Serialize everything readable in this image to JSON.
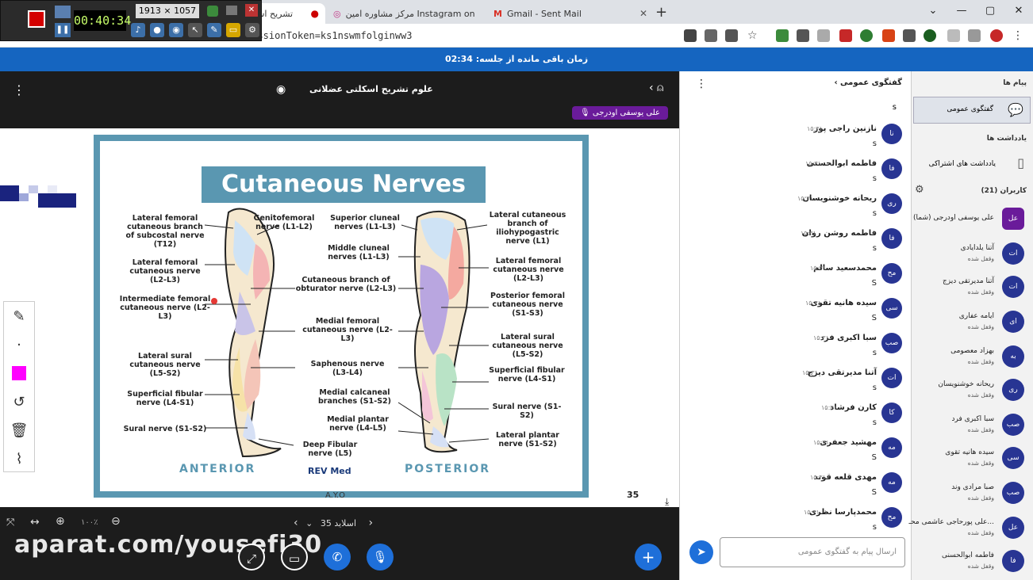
{
  "browser": {
    "tabs": [
      {
        "label": "تشریح اس"
      },
      {
        "label": "مرکز مشاوره امین Instagram on"
      },
      {
        "label": "Gmail - Sent Mail"
      }
    ],
    "url": "sessionToken=ks1nswmfolginww3"
  },
  "recorder": {
    "time": "00:40:34",
    "resolution": "1913 × 1057"
  },
  "banner": {
    "text": "زمان باقی مانده از جلسه: 02:34"
  },
  "presentation": {
    "title": "علوم تشریح اسکلتی عضلانی",
    "presenter": "علی یوسفی اودرجی",
    "slide": {
      "title": "Cutaneous Nerves",
      "anterior": "ANTERIOR",
      "posterior": "POSTERIOR",
      "brand": "REV Med",
      "page": "35",
      "footer": "A.Y.O",
      "labels_left": [
        "Lateral femoral cutaneous branch of subcostal nerve (T12)",
        "Lateral femoral cutaneous nerve (L2-L3)",
        "Intermediate femoral cutaneous nerve (L2-L3)",
        "Lateral sural cutaneous nerve (L5-S2)",
        "Superficial fibular nerve (L4-S1)",
        "Sural nerve (S1-S2)"
      ],
      "labels_middle": [
        "Genitofemoral nerve (L1-L2)",
        "Superior cluneal nerves (L1-L3)",
        "Middle cluneal nerves (L1-L3)",
        "Cutaneous branch of obturator nerve (L2-L3)",
        "Medial femoral cutaneous nerve (L2-L3)",
        "Saphenous nerve (L3-L4)",
        "Medial calcaneal branches (S1-S2)",
        "Medial plantar nerve (L4-L5)",
        "Deep Fibular nerve (L5)"
      ],
      "labels_right": [
        "Lateral cutaneous branch of iliohypogastric nerve (L1)",
        "Lateral femoral cutaneous nerve (L2-L3)",
        "Posterior femoral cutaneous nerve (S1-S3)",
        "Lateral sural cutaneous nerve (L5-S2)",
        "Superficial fibular nerve (L4-S1)",
        "Sural nerve (S1-S2)",
        "Lateral plantar nerve (S1-S2)"
      ]
    },
    "controls": {
      "zoom": "۱۰۰٪",
      "slide_label": "اسلاید 35"
    },
    "watermark": "aparat.com/yousefi30"
  },
  "chat": {
    "header": "گفتگوی عمومی",
    "input_placeholder": "ارسال پیام به گفتگوی عمومی",
    "messages": [
      {
        "initials": "نا",
        "name": "نازنین راجی پور",
        "time": "۱۵:۳۱",
        "text": "s"
      },
      {
        "initials": "فا",
        "name": "فاطمه ابوالحسنی",
        "time": "۱۵:۳۱",
        "text": "s"
      },
      {
        "initials": "ری",
        "name": "ریحانه خوشنویسان",
        "time": "۱۵:۳۱",
        "text": "s"
      },
      {
        "initials": "فا",
        "name": "فاطمه روشن روان",
        "time": "۱۵:۳۱",
        "text": "s"
      },
      {
        "initials": "مح",
        "name": "محمدسعید سالم",
        "time": "۱۵:۳۱",
        "text": "S"
      },
      {
        "initials": "سی",
        "name": "سیده هانیه تقوی",
        "time": "۱۵:۳۱",
        "text": "S"
      },
      {
        "initials": "صب",
        "name": "سبا اکبری فرد",
        "time": "۱۵:۳۱",
        "text": "s"
      },
      {
        "initials": "ات",
        "name": "آتنا مدیرتقی دیزج",
        "time": "۱۵:۳۱",
        "text": "s"
      },
      {
        "initials": "کا",
        "name": "کارن فرشاد",
        "time": "۱۵:۳۱",
        "text": "s"
      },
      {
        "initials": "مه",
        "name": "مهشید جعفری",
        "time": "۱۵:۳۱",
        "text": "S"
      },
      {
        "initials": "مه",
        "name": "مهدی قلعه قوند",
        "time": "۱۵:۳۱",
        "text": "S"
      },
      {
        "initials": "مح",
        "name": "محمدپارسا نظری",
        "time": "۱۵:۳۱",
        "text": "s"
      }
    ]
  },
  "users": {
    "messages_header": "پیام ها",
    "public_chat": "گفتگوی عمومی",
    "notes_header": "یادداشت ها",
    "shared_notes": "یادداشت های اشتراکی",
    "users_header": "کاربران (21)",
    "list": [
      {
        "initials": "عل",
        "name": "علی یوسفی اودرجی (شما)",
        "status": ""
      },
      {
        "initials": "ات",
        "name": "آتنا یلدایادی",
        "status": "وقفل شده"
      },
      {
        "initials": "ات",
        "name": "آتنا مدیرتقی دیزج",
        "status": "وقفل شده"
      },
      {
        "initials": "ای",
        "name": "ایامه عفاری",
        "status": "وقفل شده"
      },
      {
        "initials": "به",
        "name": "بهزاد معصومی",
        "status": "وقفل شده"
      },
      {
        "initials": "ری",
        "name": "ریحانه خوشنویسان",
        "status": "وقفل شده"
      },
      {
        "initials": "صب",
        "name": "سبا اکبری فرد",
        "status": "وقفل شده"
      },
      {
        "initials": "سی",
        "name": "سیده هانیه تقوی",
        "status": "وقفل شده"
      },
      {
        "initials": "صب",
        "name": "صبا مرادی وند",
        "status": "وقفل شده"
      },
      {
        "initials": "عل",
        "name": "علی پورحاجی عاشمی محـ...",
        "status": "وقفل شده"
      },
      {
        "initials": "فا",
        "name": "فاطمه ابوالحسنی",
        "status": "وقفل شده"
      }
    ]
  }
}
